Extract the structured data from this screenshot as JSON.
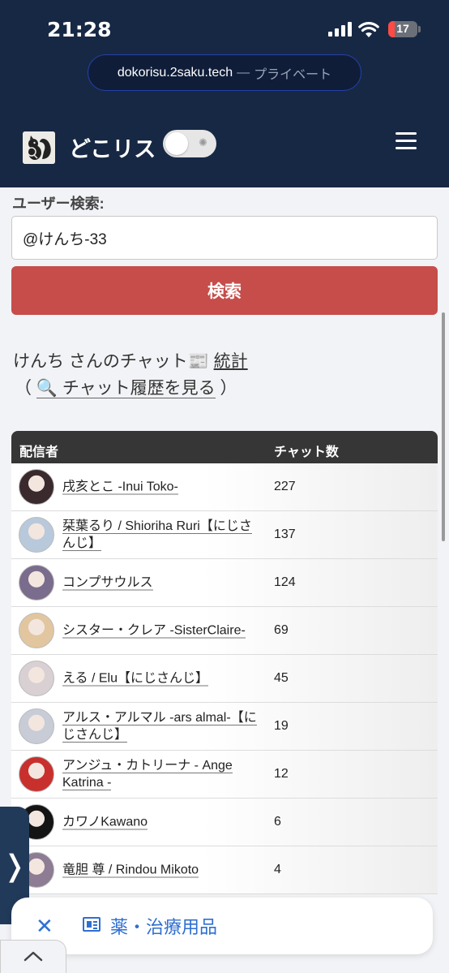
{
  "status_bar": {
    "time": "21:28",
    "battery": "17"
  },
  "url_bar": {
    "domain": "dokorisu.2saku.tech",
    "separator": "—",
    "mode": "プライベート"
  },
  "header": {
    "site_name": "どこリス",
    "toggle_icon": "sun-icon",
    "menu_icon": "hamburger-icon"
  },
  "search": {
    "label": "ユーザー検索:",
    "value": "@けんち-33",
    "button": "検索"
  },
  "stats": {
    "title_prefix": "けんち さんのチャット",
    "title_icon": "📰",
    "title_link": "統計",
    "open_paren": "（",
    "history_icon": "🔍",
    "history_link": "チャット履歴を見る",
    "close_paren": "）"
  },
  "table": {
    "headers": {
      "streamer": "配信者",
      "chat_count": "チャット数"
    },
    "rows": [
      {
        "name": "戌亥とこ -Inui Toko-",
        "count": "227",
        "avatar_color": "#3a2a2e"
      },
      {
        "name": "栞葉るり / Shioriha Ruri【にじさんじ】",
        "count": "137",
        "avatar_color": "#b9c9dc"
      },
      {
        "name": "コンプサウルス",
        "count": "124",
        "avatar_color": "#7a6c8c"
      },
      {
        "name": "シスター・クレア -SisterClaire-",
        "count": "69",
        "avatar_color": "#e2c6a0"
      },
      {
        "name": "える / Elu【にじさんじ】",
        "count": "45",
        "avatar_color": "#d9d0d3"
      },
      {
        "name": "アルス・アルマル -ars almal-【にじさんじ】",
        "count": "19",
        "avatar_color": "#c7ccd6"
      },
      {
        "name": "アンジュ・カトリーナ - Ange Katrina -",
        "count": "12",
        "avatar_color": "#c8302e"
      },
      {
        "name": "カワノKawano",
        "count": "6",
        "avatar_color": "#141414"
      },
      {
        "name": "竜胆 尊 / Rindou Mikoto",
        "count": "4",
        "avatar_color": "#8d7c93"
      }
    ]
  },
  "side_tab": {
    "icon": "chevron-right-icon",
    "glyph": "❭"
  },
  "ad_bar": {
    "close_glyph": "✕",
    "text": "薬・治療用品"
  },
  "bottom_tab": {
    "icon": "chevron-up-icon"
  },
  "colors": {
    "header_bg": "#172844",
    "accent": "#c64d4a",
    "link_blue": "#2f6fd0"
  }
}
